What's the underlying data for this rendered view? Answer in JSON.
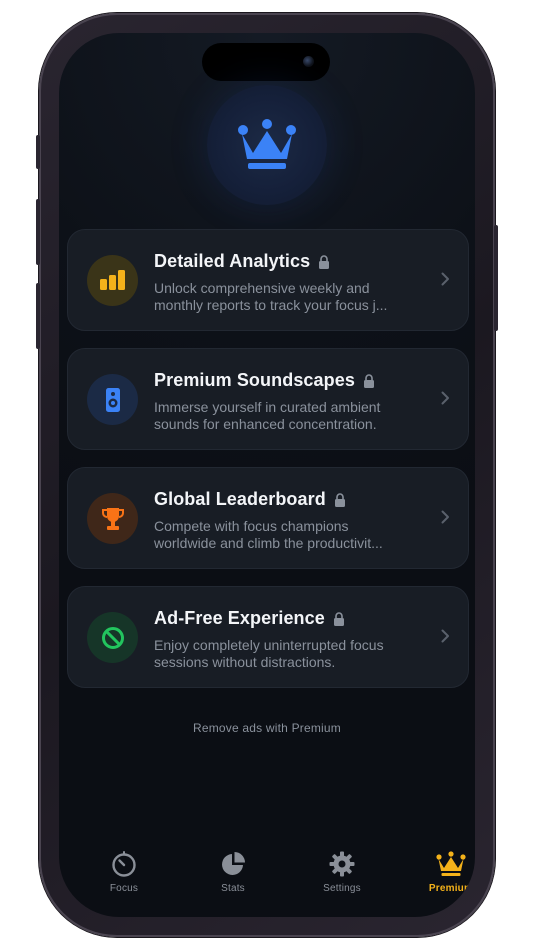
{
  "colors": {
    "screen_bg": "#0d1118",
    "card_bg": "#181d25",
    "accent_blue": "#3b82f6",
    "accent_yellow": "#f4b21a",
    "accent_orange": "#f97316",
    "accent_green": "#22c55e",
    "text_primary": "#f3f5f8",
    "text_secondary": "#8a919c"
  },
  "hero": {
    "icon": "crown-icon"
  },
  "features": [
    {
      "title": "Detailed Analytics",
      "desc_line1": "Unlock comprehensive weekly and",
      "desc_line2": "monthly reports to track your focus j...",
      "icon": "bar-chart-icon",
      "locked": true
    },
    {
      "title": "Premium Soundscapes",
      "desc_line1": "Immerse yourself in curated ambient",
      "desc_line2": "sounds for enhanced concentration.",
      "icon": "speaker-icon",
      "locked": true
    },
    {
      "title": "Global Leaderboard",
      "desc_line1": "Compete with focus champions",
      "desc_line2": "worldwide and climb the productivit...",
      "icon": "trophy-icon",
      "locked": true
    },
    {
      "title": "Ad-Free Experience",
      "desc_line1": "Enjoy completely uninterrupted focus",
      "desc_line2": "sessions without distractions.",
      "icon": "no-ads-icon",
      "locked": true
    }
  ],
  "footer_note": "Remove ads with Premium",
  "tabs": [
    {
      "label": "Focus",
      "icon": "timer-icon",
      "active": false
    },
    {
      "label": "Stats",
      "icon": "pie-chart-icon",
      "active": false
    },
    {
      "label": "Settings",
      "icon": "gear-icon",
      "active": false
    },
    {
      "label": "Premium",
      "icon": "crown-icon",
      "active": true
    }
  ]
}
